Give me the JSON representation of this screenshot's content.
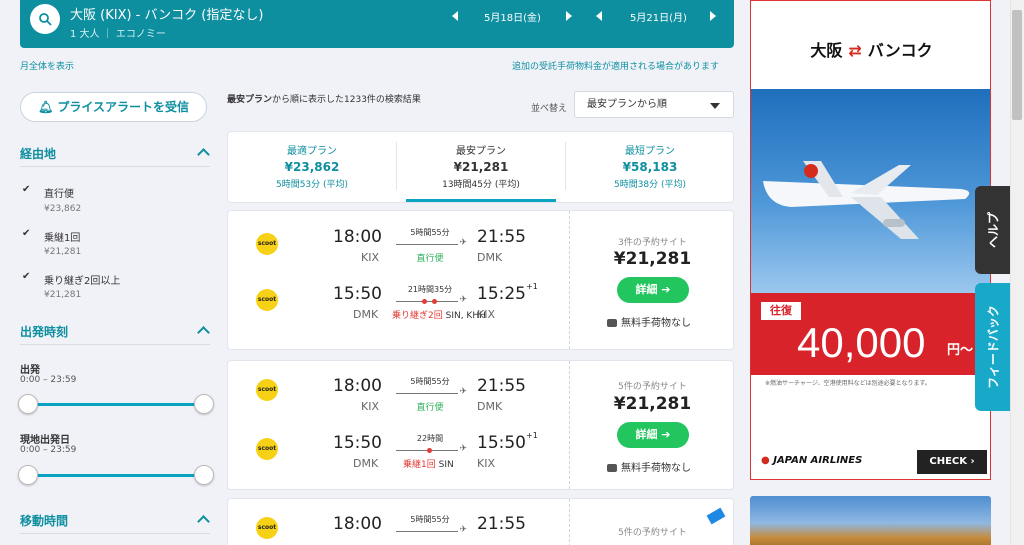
{
  "search": {
    "route": "大阪 (KIX) - バンコク (指定なし)",
    "passengers": "1 大人",
    "cabin": "エコノミー",
    "depart_date": "5月18日(金)",
    "return_date": "5月21日(月)"
  },
  "links": {
    "month_view": "月全体を表示",
    "baggage_notice": "追加の受託手荷物料金が適用される場合があります"
  },
  "sidebar": {
    "price_alert": "プライスアラートを受信",
    "stops": {
      "title": "経由地",
      "options": [
        {
          "label": "直行便",
          "price": "¥23,862",
          "checked": true
        },
        {
          "label": "乗継1回",
          "price": "¥21,281",
          "checked": true
        },
        {
          "label": "乗り継ぎ2回以上",
          "price": "¥21,281",
          "checked": true
        }
      ]
    },
    "departure": {
      "title": "出発時刻",
      "outbound_label": "出発",
      "outbound_range": "0:00 – 23:59",
      "return_label": "現地出発日",
      "return_range": "0:00 – 23:59"
    },
    "duration": {
      "title": "移動時間"
    }
  },
  "results": {
    "summary_bold": "最安プラン",
    "summary_rest": "から順に表示した1233件の検索結果",
    "sort_label": "並べ替え",
    "sort_value": "最安プランから順"
  },
  "tabs": [
    {
      "label": "最適プラン",
      "price": "¥23,862",
      "duration": "5時間53分 (平均)"
    },
    {
      "label": "最安プラン",
      "price": "¥21,281",
      "duration": "13時間45分 (平均)"
    },
    {
      "label": "最短プラン",
      "price": "¥58,183",
      "duration": "5時間38分 (平均)"
    }
  ],
  "cards": [
    {
      "outbound": {
        "airline": "scoot",
        "dep_time": "18:00",
        "dep_code": "KIX",
        "duration": "5時間55分",
        "stops": "直行便",
        "arr_time": "21:55",
        "arr_code": "DMK"
      },
      "inbound": {
        "airline": "scoot",
        "dep_time": "15:50",
        "dep_code": "DMK",
        "duration": "21時間35分",
        "stops": "乗り継ぎ2回",
        "via": "SIN, KHH",
        "arr_time": "15:25",
        "arr_code": "KIX",
        "day_offset": "+1"
      },
      "sites": "3件の予約サイト",
      "price": "¥21,281",
      "detail_label": "詳細 ➔",
      "baggage": "無料手荷物なし"
    },
    {
      "outbound": {
        "airline": "scoot",
        "dep_time": "18:00",
        "dep_code": "KIX",
        "duration": "5時間55分",
        "stops": "直行便",
        "arr_time": "21:55",
        "arr_code": "DMK"
      },
      "inbound": {
        "airline": "scoot",
        "dep_time": "15:50",
        "dep_code": "DMK",
        "duration": "22時間",
        "stops": "乗継1回",
        "via": "SIN",
        "arr_time": "15:50",
        "arr_code": "KIX",
        "day_offset": "+1"
      },
      "sites": "5件の予約サイト",
      "price": "¥21,281",
      "detail_label": "詳細 ➔",
      "baggage": "無料手荷物なし"
    },
    {
      "outbound": {
        "airline": "scoot",
        "dep_time": "18:00",
        "dep_code": "KIX",
        "duration": "5時間55分",
        "stops": "直行便",
        "arr_time": "21:55",
        "arr_code": "DMK"
      },
      "sites": "5件の予約サイト"
    }
  ],
  "ad": {
    "origin": "大阪",
    "arrows": "⇄",
    "destination": "バンコク",
    "roundtrip": "往復",
    "price": "40,000",
    "yen": "円〜",
    "note": "※燃油サーチャージ、空港使用料などは別途必要となります。",
    "airline": "JAPAN AIRLINES",
    "check": "CHECK ›"
  },
  "side_tabs": {
    "help": "ヘルプ",
    "feedback": "フィードバック"
  },
  "colors": {
    "brand": "#0e8fa0",
    "cta_green": "#22c55e",
    "stop_red": "#e53935",
    "nonstop_green": "#2eaf5a",
    "ad_red": "#d8232a"
  }
}
